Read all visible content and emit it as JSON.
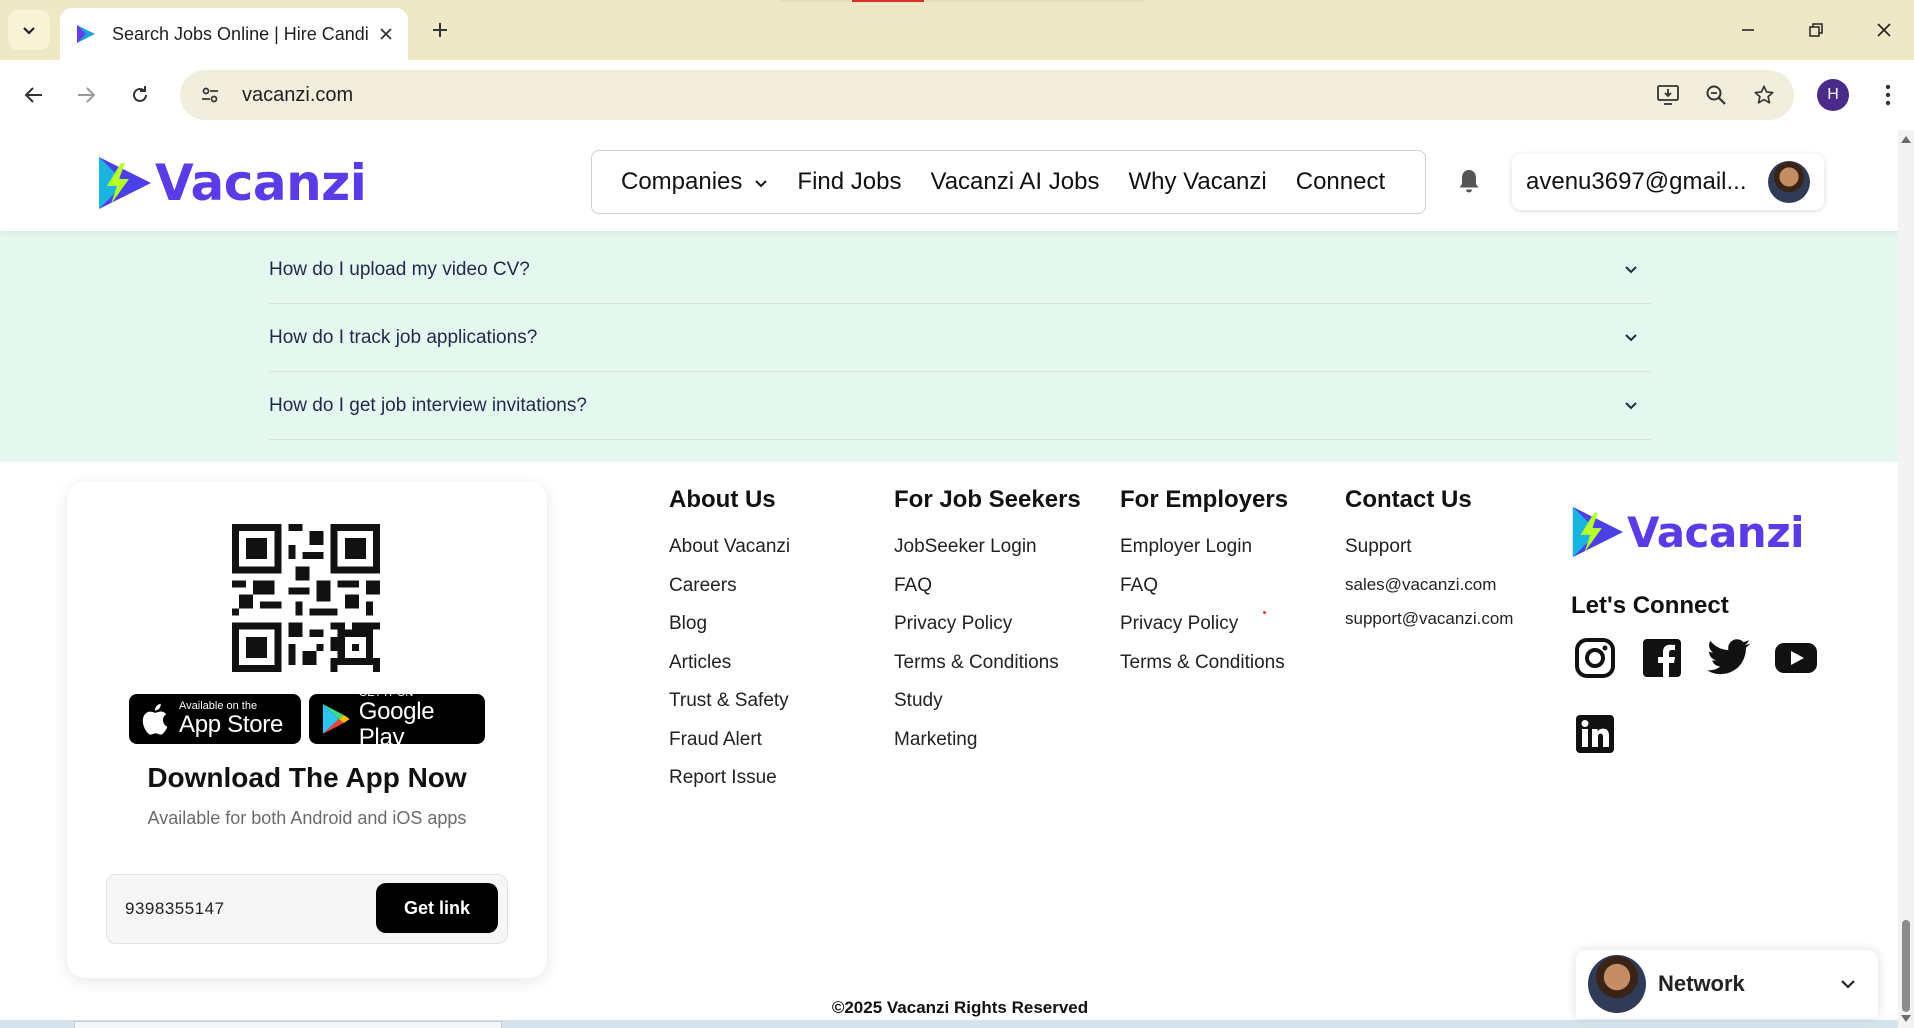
{
  "browser": {
    "tab_title": "Search Jobs Online | Hire Candi",
    "url": "vacanzi.com",
    "profile_initial": "H",
    "icons": [
      "tab-search-icon",
      "favicon",
      "close-tab-icon",
      "new-tab-icon",
      "minimize-icon",
      "restore-icon",
      "close-window-icon",
      "back-icon",
      "forward-icon",
      "reload-icon",
      "site-settings-icon",
      "install-app-icon",
      "zoom-icon",
      "bookmark-star-icon",
      "menu-kebab-icon"
    ]
  },
  "header": {
    "logo_text": "Vacanzi",
    "nav": {
      "companies": "Companies",
      "find_jobs": "Find Jobs",
      "ai_jobs": "Vacanzi AI Jobs",
      "why": "Why Vacanzi",
      "connect": "Connect"
    },
    "account_email": "avenu3697@gmail..."
  },
  "faq": {
    "items": [
      "How do I upload my video CV?",
      "How do I track job applications?",
      "How do I get job interview invitations?"
    ]
  },
  "app_card": {
    "apple_small": "Available on the",
    "apple_big": "App Store",
    "google_small": "GET IT ON",
    "google_big": "Google Play",
    "title": "Download The App Now",
    "subtitle": "Available for both Android and iOS apps",
    "phone_value": "9398355147",
    "get_link": "Get link"
  },
  "footer": {
    "about": {
      "heading": "About Us",
      "links": [
        "About Vacanzi",
        "Careers",
        "Blog",
        "Articles",
        "Trust & Safety",
        "Fraud Alert",
        "Report Issue"
      ]
    },
    "seekers": {
      "heading": "For Job Seekers",
      "links": [
        "JobSeeker Login",
        "FAQ",
        "Privacy Policy",
        "Terms & Conditions",
        "Study",
        "Marketing"
      ]
    },
    "employers": {
      "heading": "For Employers",
      "links": [
        "Employer Login",
        "FAQ",
        "Privacy Policy",
        "Terms & Conditions"
      ]
    },
    "contact": {
      "heading": "Contact Us",
      "support": "Support",
      "sales_email": "sales@vacanzi.com",
      "support_email": "support@vacanzi.com"
    },
    "logo_text": "Vacanzi",
    "lets_connect": "Let's Connect",
    "social": [
      "instagram-icon",
      "facebook-icon",
      "twitter-icon",
      "youtube-icon",
      "linkedin-icon"
    ],
    "copyright": "©2025 Vacanzi Rights Reserved"
  },
  "network_widget": {
    "label": "Network"
  },
  "colors": {
    "brand_purple": "#5b3be6",
    "faq_bg": "#e5f8f0",
    "tabbar_bg": "#efe8c6"
  }
}
